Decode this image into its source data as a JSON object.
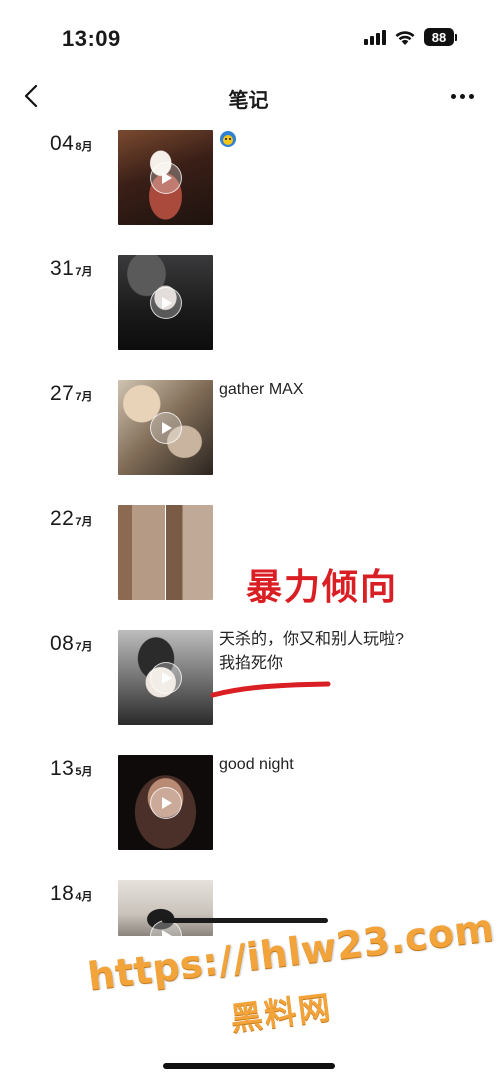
{
  "status_bar": {
    "time": "13:09",
    "battery": "88",
    "icons": [
      "signal-icon",
      "wifi-icon",
      "battery-icon"
    ]
  },
  "nav": {
    "title": "笔记",
    "back_icon": "chevron-left-icon",
    "more_icon": "more-dots-icon"
  },
  "notes": [
    {
      "day": "04",
      "month": "8月",
      "caption": "",
      "has_emoji": true,
      "is_video": true
    },
    {
      "day": "31",
      "month": "7月",
      "caption": "",
      "is_video": true
    },
    {
      "day": "27",
      "month": "7月",
      "caption": "gather MAX",
      "is_video": true
    },
    {
      "day": "22",
      "month": "7月",
      "caption": "",
      "is_video": false
    },
    {
      "day": "08",
      "month": "7月",
      "caption": "天杀的，你又和别人玩啦?",
      "caption_line2": "我掐死你",
      "is_video": true
    },
    {
      "day": "13",
      "month": "5月",
      "caption": "good night",
      "is_video": true
    },
    {
      "day": "18",
      "month": "4月",
      "caption": "",
      "is_video": true
    }
  ],
  "overlay": {
    "annotation_text": "暴力倾向",
    "annotation_color": "#d91e24"
  },
  "watermark": {
    "url": "https://ihlw23.com",
    "site_name": "黑料网",
    "color": "#f2a33a"
  }
}
